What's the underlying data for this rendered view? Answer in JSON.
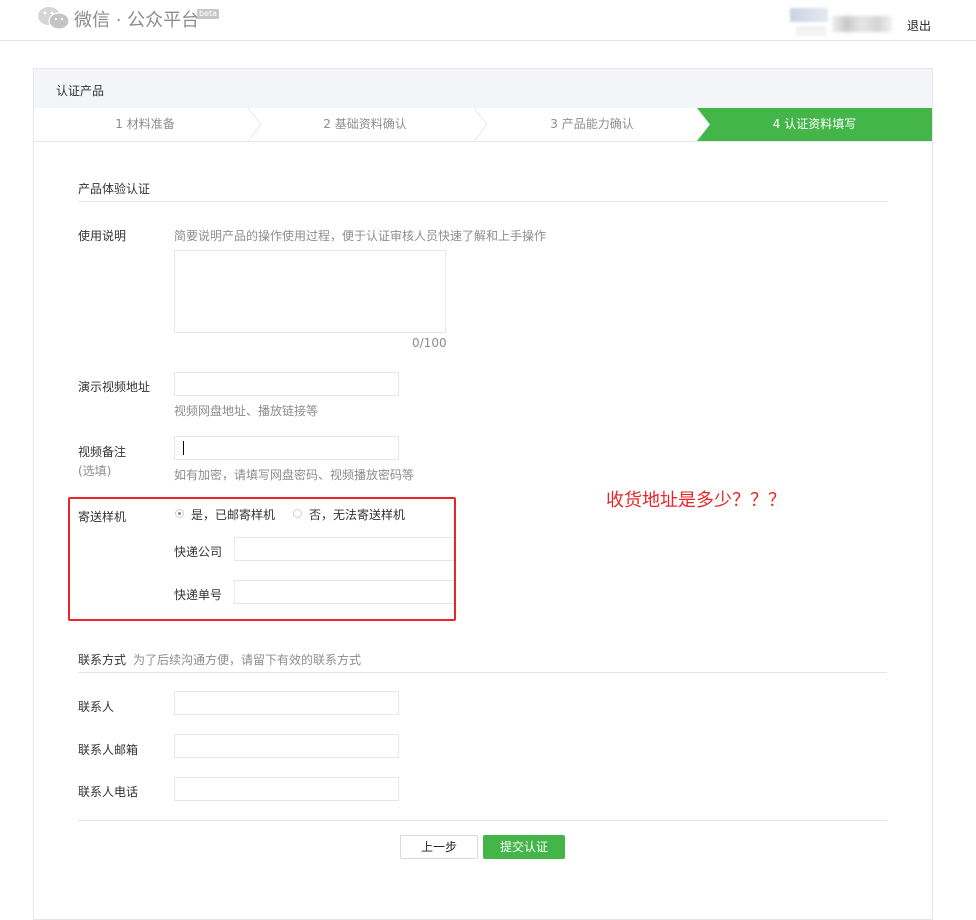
{
  "header": {
    "brand": "微信 · 公众平台",
    "beta": "beta",
    "logout": "退出"
  },
  "panel": {
    "title": "认证产品",
    "steps": [
      "1 材料准备",
      "2 基础资料确认",
      "3 产品能力确认",
      "4 认证资料填写"
    ],
    "active_step": 4
  },
  "section1": {
    "title": "产品体验认证",
    "usage_label": "使用说明",
    "usage_hint": "简要说明产品的操作使用过程，便于认证审核人员快速了解和上手操作",
    "usage_value": "",
    "usage_counter": "0/100",
    "video_url_label": "演示视频地址",
    "video_url_value": "",
    "video_url_hint": "视频网盘地址、播放链接等",
    "video_note_label": "视频备注",
    "video_note_optional": "(选填)",
    "video_note_value": "",
    "video_note_hint": "如有加密，请填写网盘密码、视频播放密码等",
    "sample_label": "寄送样机",
    "sample_yes": "是，已邮寄样机",
    "sample_no": "否，无法寄送样机",
    "sample_selected": "yes",
    "courier_company_label": "快递公司",
    "courier_company_value": "",
    "courier_number_label": "快递单号",
    "courier_number_value": ""
  },
  "annotation": "收货地址是多少？？？",
  "annotation_color": "#e8262a",
  "section2": {
    "title": "联系方式",
    "subtitle": "为了后续沟通方便，请留下有效的联系方式",
    "contact_label": "联系人",
    "contact_value": "",
    "email_label": "联系人邮箱",
    "email_value": "",
    "phone_label": "联系人电话",
    "phone_value": ""
  },
  "buttons": {
    "prev": "上一步",
    "submit": "提交认证"
  },
  "colors": {
    "accent": "#44b549",
    "border": "#e7e7eb"
  }
}
